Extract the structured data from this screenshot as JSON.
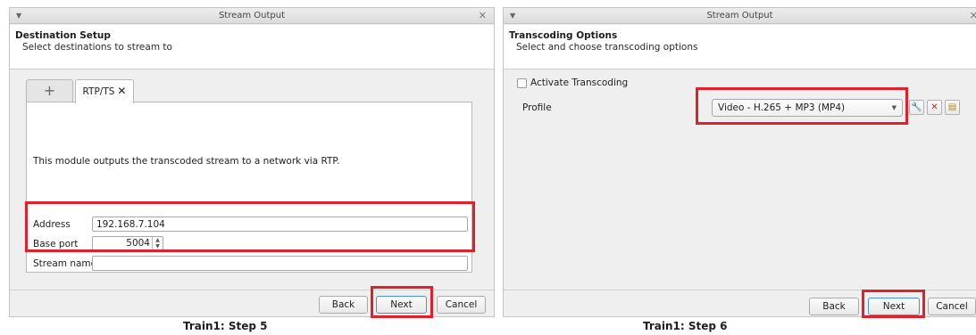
{
  "window_title": "Stream Output",
  "step5": {
    "header_title": "Destination Setup",
    "header_subtitle": "Select destinations to stream to",
    "tab_add": "+",
    "tab_name": "RTP/TS",
    "description": "This module outputs the transcoded stream to a network via RTP.",
    "address_label": "Address",
    "address_value": "192.168.7.104",
    "base_port_label": "Base port",
    "base_port_value": "5004",
    "stream_name_label": "Stream name",
    "stream_name_value": "",
    "back_label": "Back",
    "next_label": "Next",
    "cancel_label": "Cancel",
    "caption": "Train1: Step 5"
  },
  "step6": {
    "header_title": "Transcoding Options",
    "header_subtitle": "Select and choose transcoding options",
    "activate_label": "Activate Transcoding",
    "profile_label": "Profile",
    "profile_value": "Video - H.265 + MP3 (MP4)",
    "back_label": "Back",
    "next_label": "Next",
    "cancel_label": "Cancel",
    "caption": "Train1: Step 6"
  },
  "colors": {
    "highlight": "#e0202a",
    "default_button_border": "#4a90d9",
    "delete_icon": "#d42020"
  },
  "icons": {
    "menu": "chevron-down-icon",
    "close": "close-icon",
    "tab_close": "close-icon",
    "edit_profile": "wrench-icon",
    "delete_profile": "delete-icon",
    "new_profile": "new-profile-icon"
  }
}
